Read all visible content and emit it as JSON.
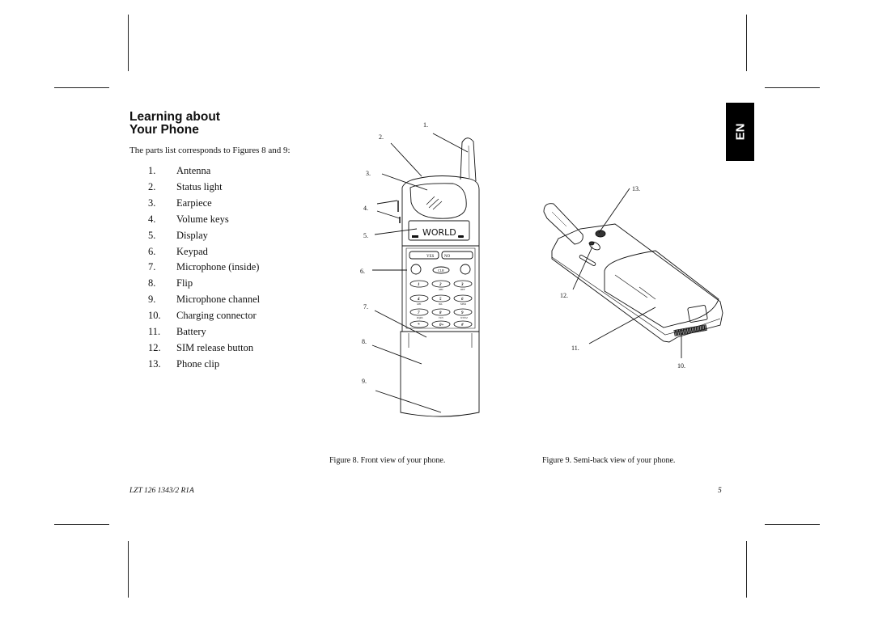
{
  "heading": {
    "line1": "Learning about",
    "line2": "Your Phone"
  },
  "intro": "The parts list corresponds to Figures 8 and 9:",
  "parts": [
    {
      "num": "1.",
      "label": "Antenna"
    },
    {
      "num": "2.",
      "label": "Status light"
    },
    {
      "num": "3.",
      "label": "Earpiece"
    },
    {
      "num": "4.",
      "label": "Volume keys"
    },
    {
      "num": "5.",
      "label": "Display"
    },
    {
      "num": "6.",
      "label": "Keypad"
    },
    {
      "num": "7.",
      "label": "Microphone (inside)"
    },
    {
      "num": "8.",
      "label": "Flip"
    },
    {
      "num": "9.",
      "label": "Microphone channel"
    },
    {
      "num": "10.",
      "label": "Charging connector"
    },
    {
      "num": "11.",
      "label": "Battery"
    },
    {
      "num": "12.",
      "label": "SIM release button"
    },
    {
      "num": "13.",
      "label": "Phone clip"
    }
  ],
  "language_tab": "EN",
  "figure8": {
    "caption": "Figure 8. Front view of your phone.",
    "callouts": [
      "1.",
      "2.",
      "3.",
      "4.",
      "5.",
      "6.",
      "7.",
      "8.",
      "9."
    ],
    "display_text": "WORLD",
    "keys": {
      "yes": "YES",
      "no": "NO",
      "clr": "CLR",
      "digits": [
        "1",
        "2",
        "3",
        "4",
        "5",
        "6",
        "7",
        "8",
        "9",
        "*",
        "0+",
        "#"
      ],
      "letters": [
        "",
        "ABC",
        "DEF",
        "GHI",
        "JKL",
        "MNO",
        "PQRS",
        "TUV",
        "WXYZ"
      ]
    }
  },
  "figure9": {
    "caption": "Figure 9. Semi-back view of your phone.",
    "callouts": [
      "13.",
      "12.",
      "11.",
      "10."
    ]
  },
  "footer": {
    "doc_id": "LZT 126 1343/2 R1A",
    "page": "5"
  }
}
